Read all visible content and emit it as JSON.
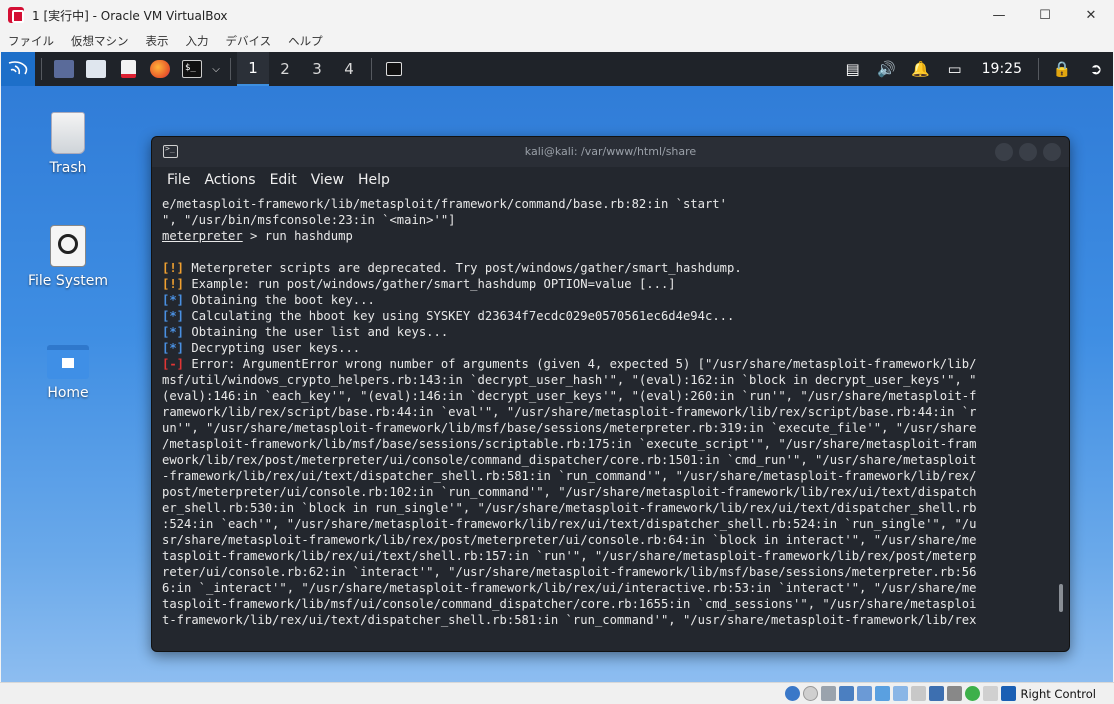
{
  "vbox": {
    "title": "1 [実行中] - Oracle VM VirtualBox",
    "menu": [
      "ファイル",
      "仮想マシン",
      "表示",
      "入力",
      "デバイス",
      "ヘルプ"
    ],
    "host_key": "Right Control"
  },
  "panel": {
    "workspaces": [
      "1",
      "2",
      "3",
      "4"
    ],
    "active_workspace": "1",
    "clock": "19:25"
  },
  "desktop": {
    "icons": [
      {
        "label": "Trash",
        "icon": "trash-icon"
      },
      {
        "label": "File System",
        "icon": "drive-icon"
      },
      {
        "label": "Home",
        "icon": "home-folder-icon"
      }
    ]
  },
  "terminal": {
    "title": "kali@kali: /var/www/html/share",
    "menu": [
      "File",
      "Actions",
      "Edit",
      "View",
      "Help"
    ],
    "lines": [
      {
        "tag": "",
        "text": "e/metasploit-framework/lib/metasploit/framework/command/base.rb:82:in `start'"
      },
      {
        "tag": "",
        "text": "\", \"/usr/bin/msfconsole:23:in `<main>'\"]"
      },
      {
        "prompt": "meterpreter",
        "text": " > run hashdump"
      },
      {
        "tag": "",
        "text": ""
      },
      {
        "tag": "[!]",
        "kind": "warn",
        "text": " Meterpreter scripts are deprecated. Try post/windows/gather/smart_hashdump."
      },
      {
        "tag": "[!]",
        "kind": "warn",
        "text": " Example: run post/windows/gather/smart_hashdump OPTION=value [...]"
      },
      {
        "tag": "[*]",
        "kind": "info",
        "text": " Obtaining the boot key..."
      },
      {
        "tag": "[*]",
        "kind": "info",
        "text": " Calculating the hboot key using SYSKEY d23634f7ecdc029e0570561ec6d4e94c..."
      },
      {
        "tag": "[*]",
        "kind": "info",
        "text": " Obtaining the user list and keys..."
      },
      {
        "tag": "[*]",
        "kind": "info",
        "text": " Decrypting user keys..."
      },
      {
        "tag": "[-]",
        "kind": "err",
        "text": " Error: ArgumentError wrong number of arguments (given 4, expected 5) [\"/usr/share/metasploit-framework/lib/"
      },
      {
        "tag": "",
        "text": "msf/util/windows_crypto_helpers.rb:143:in `decrypt_user_hash'\", \"(eval):162:in `block in decrypt_user_keys'\", \""
      },
      {
        "tag": "",
        "text": "(eval):146:in `each_key'\", \"(eval):146:in `decrypt_user_keys'\", \"(eval):260:in `run'\", \"/usr/share/metasploit-f"
      },
      {
        "tag": "",
        "text": "ramework/lib/rex/script/base.rb:44:in `eval'\", \"/usr/share/metasploit-framework/lib/rex/script/base.rb:44:in `r"
      },
      {
        "tag": "",
        "text": "un'\", \"/usr/share/metasploit-framework/lib/msf/base/sessions/meterpreter.rb:319:in `execute_file'\", \"/usr/share"
      },
      {
        "tag": "",
        "text": "/metasploit-framework/lib/msf/base/sessions/scriptable.rb:175:in `execute_script'\", \"/usr/share/metasploit-fram"
      },
      {
        "tag": "",
        "text": "ework/lib/rex/post/meterpreter/ui/console/command_dispatcher/core.rb:1501:in `cmd_run'\", \"/usr/share/metasploit"
      },
      {
        "tag": "",
        "text": "-framework/lib/rex/ui/text/dispatcher_shell.rb:581:in `run_command'\", \"/usr/share/metasploit-framework/lib/rex/"
      },
      {
        "tag": "",
        "text": "post/meterpreter/ui/console.rb:102:in `run_command'\", \"/usr/share/metasploit-framework/lib/rex/ui/text/dispatch"
      },
      {
        "tag": "",
        "text": "er_shell.rb:530:in `block in run_single'\", \"/usr/share/metasploit-framework/lib/rex/ui/text/dispatcher_shell.rb"
      },
      {
        "tag": "",
        "text": ":524:in `each'\", \"/usr/share/metasploit-framework/lib/rex/ui/text/dispatcher_shell.rb:524:in `run_single'\", \"/u"
      },
      {
        "tag": "",
        "text": "sr/share/metasploit-framework/lib/rex/post/meterpreter/ui/console.rb:64:in `block in interact'\", \"/usr/share/me"
      },
      {
        "tag": "",
        "text": "tasploit-framework/lib/rex/ui/text/shell.rb:157:in `run'\", \"/usr/share/metasploit-framework/lib/rex/post/meterp"
      },
      {
        "tag": "",
        "text": "reter/ui/console.rb:62:in `interact'\", \"/usr/share/metasploit-framework/lib/msf/base/sessions/meterpreter.rb:56"
      },
      {
        "tag": "",
        "text": "6:in `_interact'\", \"/usr/share/metasploit-framework/lib/rex/ui/interactive.rb:53:in `interact'\", \"/usr/share/me"
      },
      {
        "tag": "",
        "text": "tasploit-framework/lib/msf/ui/console/command_dispatcher/core.rb:1655:in `cmd_sessions'\", \"/usr/share/metasploi"
      },
      {
        "tag": "",
        "text": "t-framework/lib/rex/ui/text/dispatcher_shell.rb:581:in `run_command'\", \"/usr/share/metasploit-framework/lib/rex"
      }
    ]
  }
}
